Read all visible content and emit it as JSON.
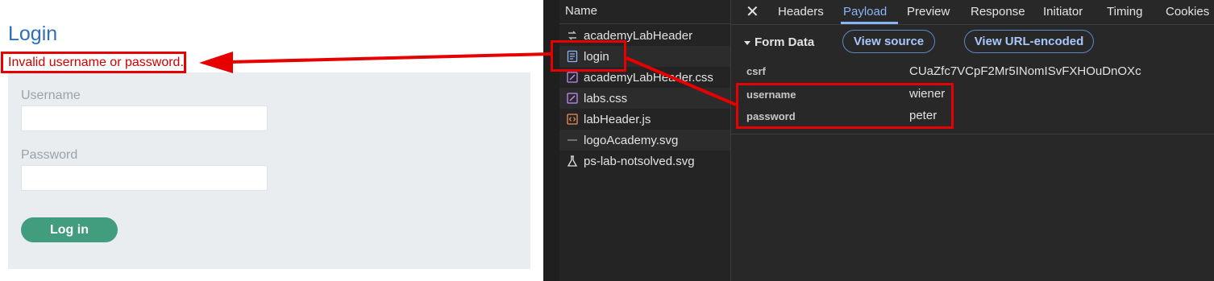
{
  "login": {
    "title": "Login",
    "error": "Invalid username or password.",
    "username_label": "Username",
    "password_label": "Password",
    "button": "Log in"
  },
  "devtools": {
    "name_header": "Name",
    "requests": [
      {
        "name": "academyLabHeader",
        "icon": "websocket-icon"
      },
      {
        "name": "login",
        "icon": "document-icon"
      },
      {
        "name": "academyLabHeader.css",
        "icon": "stylesheet-icon"
      },
      {
        "name": "labs.css",
        "icon": "stylesheet-icon"
      },
      {
        "name": "labHeader.js",
        "icon": "script-icon"
      },
      {
        "name": "logoAcademy.svg",
        "icon": "image-icon"
      },
      {
        "name": "ps-lab-notsolved.svg",
        "icon": "flask-icon"
      }
    ],
    "tabs": [
      "Headers",
      "Payload",
      "Preview",
      "Response",
      "Initiator",
      "Timing",
      "Cookies"
    ],
    "active_tab": "Payload",
    "form_data_title": "Form Data",
    "view_source": "View source",
    "view_url_encoded": "View URL-encoded",
    "fields": [
      {
        "key": "csrf",
        "value": "CUaZfc7VCpF2Mr5INomISvFXHOuDnOXc"
      },
      {
        "key": "username",
        "value": "wiener"
      },
      {
        "key": "password",
        "value": "peter"
      }
    ]
  },
  "colors": {
    "accent_blue": "#2c6fba",
    "error_red": "#d40000",
    "button_green": "#429c7e",
    "annotation_red": "#e60000",
    "devtools_active": "#8ab4f8"
  }
}
